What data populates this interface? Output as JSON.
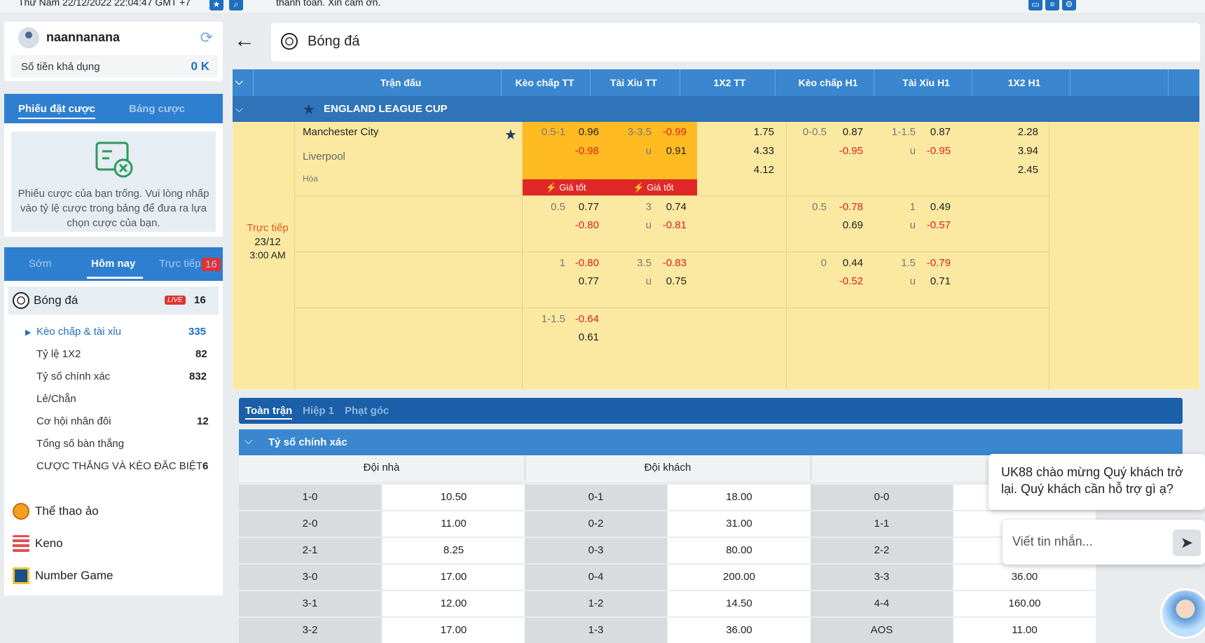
{
  "topbar": {
    "datetime": "Thứ Năm 22/12/2022 22:04:47 GMT +7",
    "marquee": "thanh toán. Xin cảm ơn."
  },
  "account": {
    "username": "naannanana",
    "balance_label": "Số tiền khả dụng",
    "balance_value": "0 K"
  },
  "slip": {
    "tab_active": "Phiếu đặt cược",
    "tab_inactive": "Bảng cược",
    "empty_text": "Phiếu cược của bạn trống. Vui lòng nhấp vào tỷ lệ cược trong bảng để đưa ra lựa chọn cược của bạn."
  },
  "menu": {
    "tabs": [
      "Sớm",
      "Hôm nay",
      "Trực tiếp"
    ],
    "live_badge": "16",
    "sport": {
      "label": "Bóng đá",
      "live": "LIVE",
      "count": "16"
    },
    "subs": [
      {
        "label": "Kèo chấp & tài xỉu",
        "count": "335"
      },
      {
        "label": "Tỷ lệ 1X2",
        "count": "82"
      },
      {
        "label": "Tỷ số chính xác",
        "count": "832"
      },
      {
        "label": "Lẻ/Chẵn",
        "count": ""
      },
      {
        "label": "Cơ hội nhân đôi",
        "count": "12"
      },
      {
        "label": "Tổng số bàn thắng",
        "count": ""
      },
      {
        "label": "CƯỢC THẮNG VÀ KÈO ĐẶC BIỆT",
        "count": "6"
      }
    ],
    "others": [
      "Thể thao ảo",
      "Keno",
      "Number Game"
    ]
  },
  "header": {
    "title": "Bóng đá"
  },
  "grid": {
    "cols": [
      "Trận đấu",
      "Kèo chấp TT",
      "Tài Xỉu TT",
      "1X2 TT",
      "Kèo chấp H1",
      "Tài Xỉu H1",
      "1X2 H1"
    ],
    "league": "ENGLAND LEAGUE CUP",
    "home": "Manchester City",
    "away": "Liverpool",
    "draw": "Hòa",
    "status": "Trực tiếp",
    "date": "23/12",
    "time": "3:00 AM",
    "good_price": "Giá tốt"
  },
  "rows": [
    {
      "hc": "0.5-1",
      "hc_h": "0.96",
      "hc_a": "-0.98",
      "ou": "3-3.5",
      "ou_o": "-0.99",
      "ou_u_lbl": "u",
      "ou_u": "0.91",
      "x1": "1.75",
      "x2": "4.33",
      "x3": "4.12",
      "h1hc": "0-0.5",
      "h1hc_h": "0.87",
      "h1hc_a": "-0.95",
      "h1ou": "1-1.5",
      "h1ou_o": "0.87",
      "h1ou_u_lbl": "u",
      "h1ou_u": "-0.95",
      "h1x1": "2.28",
      "h1x2": "3.94",
      "h1x3": "2.45"
    },
    {
      "hc": "0.5",
      "hc_h": "0.77",
      "hc_a": "-0.80",
      "ou": "3",
      "ou_o": "0.74",
      "ou_u_lbl": "u",
      "ou_u": "-0.81",
      "h1hc": "0.5",
      "h1hc_h": "-0.78",
      "h1hc_a": "0.69",
      "h1ou": "1",
      "h1ou_o": "0.49",
      "h1ou_u_lbl": "u",
      "h1ou_u": "-0.57"
    },
    {
      "hc": "1",
      "hc_h": "-0.80",
      "hc_a": "0.77",
      "ou": "3.5",
      "ou_o": "-0.83",
      "ou_u_lbl": "u",
      "ou_u": "0.75",
      "h1hc": "0",
      "h1hc_h": "0.44",
      "h1hc_a": "-0.52",
      "h1ou": "1.5",
      "h1ou_o": "-0.79",
      "h1ou_u_lbl": "u",
      "h1ou_u": "0.71"
    },
    {
      "hc": "1-1.5",
      "hc_h": "-0.64",
      "hc_a": "0.61"
    }
  ],
  "correct_score": {
    "tabs": [
      "Toàn trận",
      "Hiệp 1",
      "Phạt góc"
    ],
    "section": "Tỷ số chính xác",
    "heads": [
      "Đội nhà",
      "Đội khách",
      ""
    ],
    "rows": [
      [
        "1-0",
        "10.50",
        "0-1",
        "18.00",
        "0-0",
        ""
      ],
      [
        "2-0",
        "11.00",
        "0-2",
        "31.00",
        "1-1",
        ""
      ],
      [
        "2-1",
        "8.25",
        "0-3",
        "80.00",
        "2-2",
        ""
      ],
      [
        "3-0",
        "17.00",
        "0-4",
        "200.00",
        "3-3",
        "36.00"
      ],
      [
        "3-1",
        "12.00",
        "1-2",
        "14.50",
        "4-4",
        "160.00"
      ],
      [
        "3-2",
        "17.00",
        "1-3",
        "36.00",
        "AOS",
        "11.00"
      ]
    ]
  },
  "chat": {
    "greeting": "UK88 chào mừng Quý khách trở lại. Quý khách cần hỗ trợ gì ạ?",
    "placeholder": "Viết tin nhắn..."
  }
}
